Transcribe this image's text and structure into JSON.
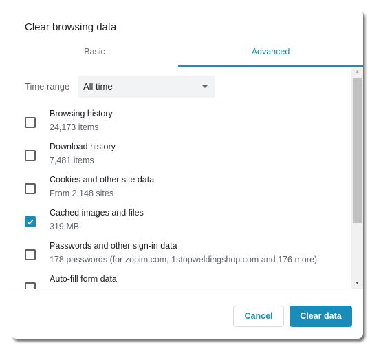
{
  "dialog": {
    "title": "Clear browsing data",
    "tabs": [
      {
        "label": "Basic",
        "active": false
      },
      {
        "label": "Advanced",
        "active": true
      }
    ],
    "time_range": {
      "label": "Time range",
      "value": "All time"
    },
    "items": [
      {
        "label": "Browsing history",
        "detail": "24,173 items",
        "checked": false
      },
      {
        "label": "Download history",
        "detail": "7,481 items",
        "checked": false
      },
      {
        "label": "Cookies and other site data",
        "detail": "From 2,148 sites",
        "checked": false
      },
      {
        "label": "Cached images and files",
        "detail": "319 MB",
        "checked": true
      },
      {
        "label": "Passwords and other sign-in data",
        "detail": "178 passwords (for zopim.com, 1stopweldingshop.com and 176 more)",
        "checked": false
      },
      {
        "label": "Auto-fill form data",
        "detail": "",
        "checked": false
      }
    ],
    "buttons": {
      "cancel": "Cancel",
      "clear": "Clear data"
    },
    "scrollbar": {
      "up_icon": "▲",
      "down_icon": "▼"
    }
  },
  "colors": {
    "accent": "#1a8cba",
    "text": "#202124",
    "secondary_text": "#5f6368"
  }
}
